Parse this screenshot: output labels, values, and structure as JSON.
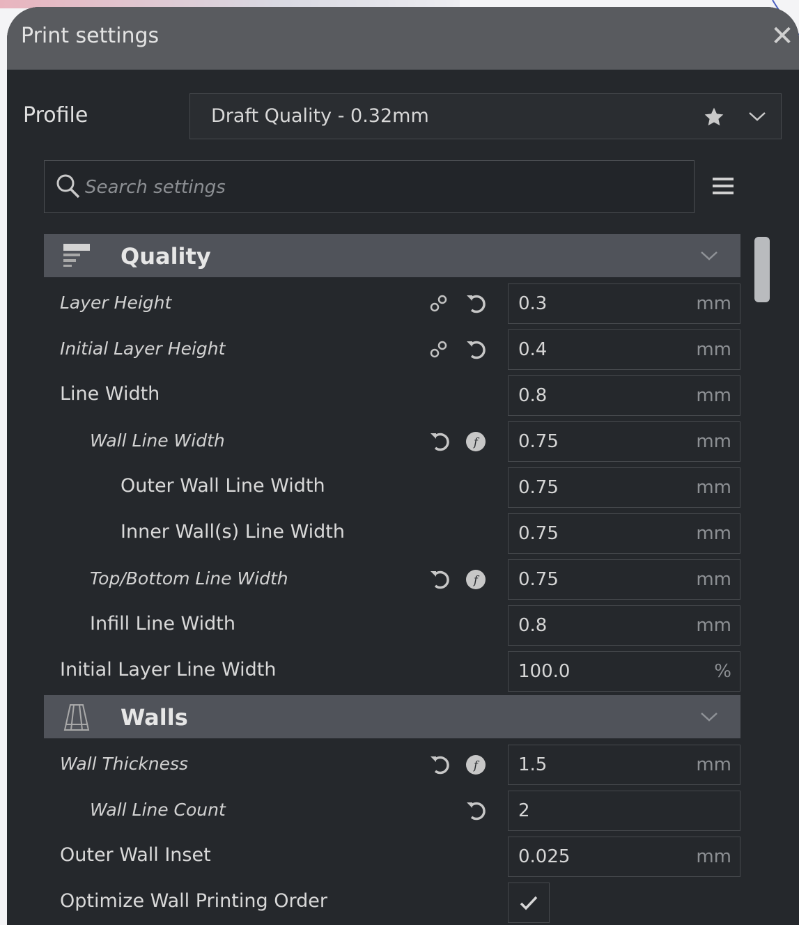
{
  "window": {
    "title": "Print settings",
    "close_glyph": "✕"
  },
  "profile": {
    "label": "Profile",
    "value": "Draft Quality - 0.32mm"
  },
  "search": {
    "placeholder": "Search settings"
  },
  "colors": {
    "panel_bg": "#25282c",
    "titlebar_bg": "#595b5f",
    "category_bg": "#50535a",
    "text": "#d9d9d9",
    "unit_text": "#8d9094"
  },
  "settings": {
    "quality": {
      "label": "Quality",
      "icon": "layer-quality-icon",
      "rows": [
        {
          "label": "Layer Height",
          "value": "0.3",
          "unit": "mm",
          "icons": [
            "link-icon",
            "reset-icon"
          ]
        },
        {
          "label": "Initial Layer Height",
          "value": "0.4",
          "unit": "mm",
          "icons": [
            "link-icon",
            "reset-icon"
          ]
        },
        {
          "label": "Line Width",
          "value": "0.8",
          "unit": "mm",
          "icons": []
        },
        {
          "label": "Wall Line Width",
          "value": "0.75",
          "unit": "mm",
          "icons": [
            "reset-icon",
            "function-icon"
          ]
        },
        {
          "label": "Outer Wall Line Width",
          "value": "0.75",
          "unit": "mm",
          "icons": []
        },
        {
          "label": "Inner Wall(s) Line Width",
          "value": "0.75",
          "unit": "mm",
          "icons": []
        },
        {
          "label": "Top/Bottom Line Width",
          "value": "0.75",
          "unit": "mm",
          "icons": [
            "reset-icon",
            "function-icon"
          ]
        },
        {
          "label": "Infill Line Width",
          "value": "0.8",
          "unit": "mm",
          "icons": []
        },
        {
          "label": "Initial Layer Line Width",
          "value": "100.0",
          "unit": "%",
          "icons": []
        }
      ]
    },
    "walls": {
      "label": "Walls",
      "icon": "walls-icon",
      "rows": [
        {
          "label": "Wall Thickness",
          "value": "1.5",
          "unit": "mm",
          "icons": [
            "reset-icon",
            "function-icon"
          ]
        },
        {
          "label": "Wall Line Count",
          "value": "2",
          "unit": "",
          "icons": [
            "reset-icon"
          ]
        },
        {
          "label": "Outer Wall Inset",
          "value": "0.025",
          "unit": "mm",
          "icons": []
        },
        {
          "label": "Optimize Wall Printing Order",
          "checked": true,
          "icons": []
        }
      ]
    }
  }
}
